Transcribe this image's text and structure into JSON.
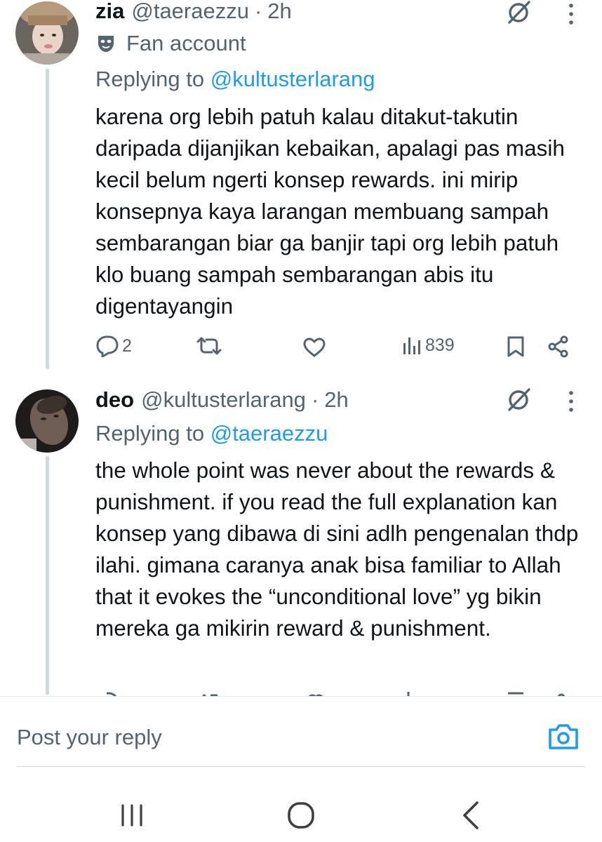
{
  "tweets": [
    {
      "name": "zia",
      "handle": "@taeraezzu",
      "separator": "·",
      "time": "2h",
      "label": "Fan account",
      "replying_prefix": "Replying to ",
      "replying_to": "@kultusterlarang",
      "text": "karena org lebih patuh kalau ditakut-takutin daripada dijanjikan kebaikan, apalagi pas masih kecil belum ngerti konsep rewards. ini mirip konsepnya kaya larangan membuang sampah sembarangan biar ga banjir tapi org lebih patuh klo buang sampah sembarangan abis itu digentayangin",
      "replies": "2",
      "views": "839"
    },
    {
      "name": "deo",
      "handle": "@kultusterlarang",
      "separator": "·",
      "time": "2h",
      "replying_prefix": "Replying to ",
      "replying_to": "@taeraezzu",
      "text": "the whole point was never about the rewards & punishment. if you read the full explanation kan konsep yang dibawa di sini adlh pengenalan thdp ilahi. gimana caranya anak bisa familiar to Allah that it evokes the “unconditional love” yg bikin mereka ga mikirin reward & punishment."
    }
  ],
  "composer": {
    "placeholder": "Post your reply"
  },
  "colors": {
    "accent": "#1d9bf0",
    "muted": "#536471",
    "text": "#0f1419"
  },
  "icons": [
    "grok-icon",
    "more-icon",
    "reply-icon",
    "retweet-icon",
    "like-icon",
    "views-icon",
    "bookmark-icon",
    "share-icon",
    "camera-icon",
    "recents-icon",
    "home-icon",
    "back-icon"
  ]
}
